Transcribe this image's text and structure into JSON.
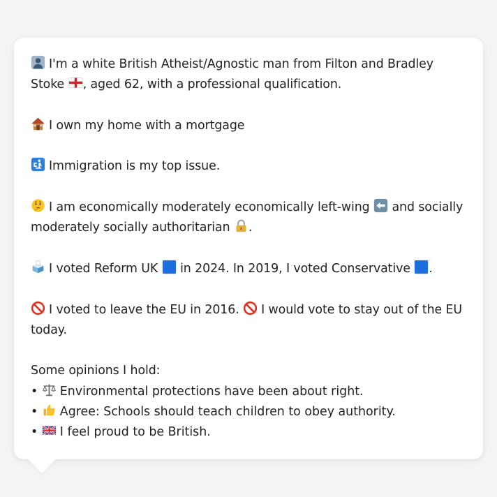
{
  "profile": {
    "identity_line": "I'm a white British Atheist/Agnostic man from Filton and Bradley Stoke",
    "identity_tail": ", aged 62, with a professional qualification.",
    "home": "I own my home with a mortgage",
    "top_issue": "Immigration is my top issue.",
    "econ_prefix": "I am economically moderately economically left-wing",
    "econ_mid": "and socially moderately socially authoritarian",
    "econ_end": ".",
    "vote_prefix": "I voted Reform UK",
    "vote_mid": "in 2024. In 2019, I voted Conservative",
    "vote_end": ".",
    "eu_a": "I voted to leave the EU in 2016.",
    "eu_b": "I would vote to stay out of the EU today.",
    "opinions_heading": "Some opinions I hold:",
    "opinions": [
      {
        "bullet": "•",
        "icon": "balance-scale-icon",
        "text": "Environmental protections have been about right."
      },
      {
        "bullet": "•",
        "icon": "thumbs-up-icon",
        "text": "Agree: Schools should teach children to obey authority."
      },
      {
        "bullet": "•",
        "icon": "uk-flag-icon",
        "text": "I feel proud to be British."
      }
    ]
  },
  "icons": {
    "identity": "person-silhouette-icon",
    "home": "house-icon",
    "issue": "passport-control-icon",
    "econ": "thinking-face-icon",
    "econ_dir": "left-arrow-icon",
    "social": "lock-icon",
    "vote": "ballot-box-icon",
    "party": "blue-square-icon",
    "eu": "prohibited-icon",
    "flag": "england-flag-icon"
  },
  "colors": {
    "bubble": "#ffffff",
    "background": "#f3f4f6",
    "text": "#222222",
    "party_blue": "#1d6fe0"
  }
}
